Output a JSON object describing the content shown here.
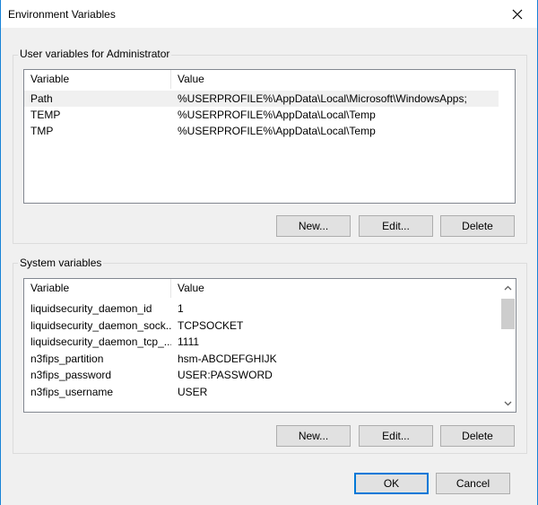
{
  "window": {
    "title": "Environment Variables"
  },
  "user_vars": {
    "group_label": "User variables for Administrator",
    "columns": [
      "Variable",
      "Value"
    ],
    "rows": [
      {
        "variable": "Path",
        "value": "%USERPROFILE%\\AppData\\Local\\Microsoft\\WindowsApps;"
      },
      {
        "variable": "TEMP",
        "value": "%USERPROFILE%\\AppData\\Local\\Temp"
      },
      {
        "variable": "TMP",
        "value": "%USERPROFILE%\\AppData\\Local\\Temp"
      }
    ],
    "buttons": {
      "new": "New...",
      "edit": "Edit...",
      "delete": "Delete"
    }
  },
  "system_vars": {
    "group_label": "System variables",
    "columns": [
      "Variable",
      "Value"
    ],
    "rows": [
      {
        "variable": "liquidsecurity_daemon_id",
        "value": "1"
      },
      {
        "variable": "liquidsecurity_daemon_sock...",
        "value": "TCPSOCKET"
      },
      {
        "variable": "liquidsecurity_daemon_tcp_...",
        "value": "1111"
      },
      {
        "variable": "n3fips_partition",
        "value": "hsm-ABCDEFGHIJK"
      },
      {
        "variable": "n3fips_password",
        "value": "USER:PASSWORD"
      },
      {
        "variable": "n3fips_username",
        "value": "USER"
      }
    ],
    "buttons": {
      "new": "New...",
      "edit": "Edit...",
      "delete": "Delete"
    }
  },
  "footer": {
    "ok": "OK",
    "cancel": "Cancel"
  }
}
